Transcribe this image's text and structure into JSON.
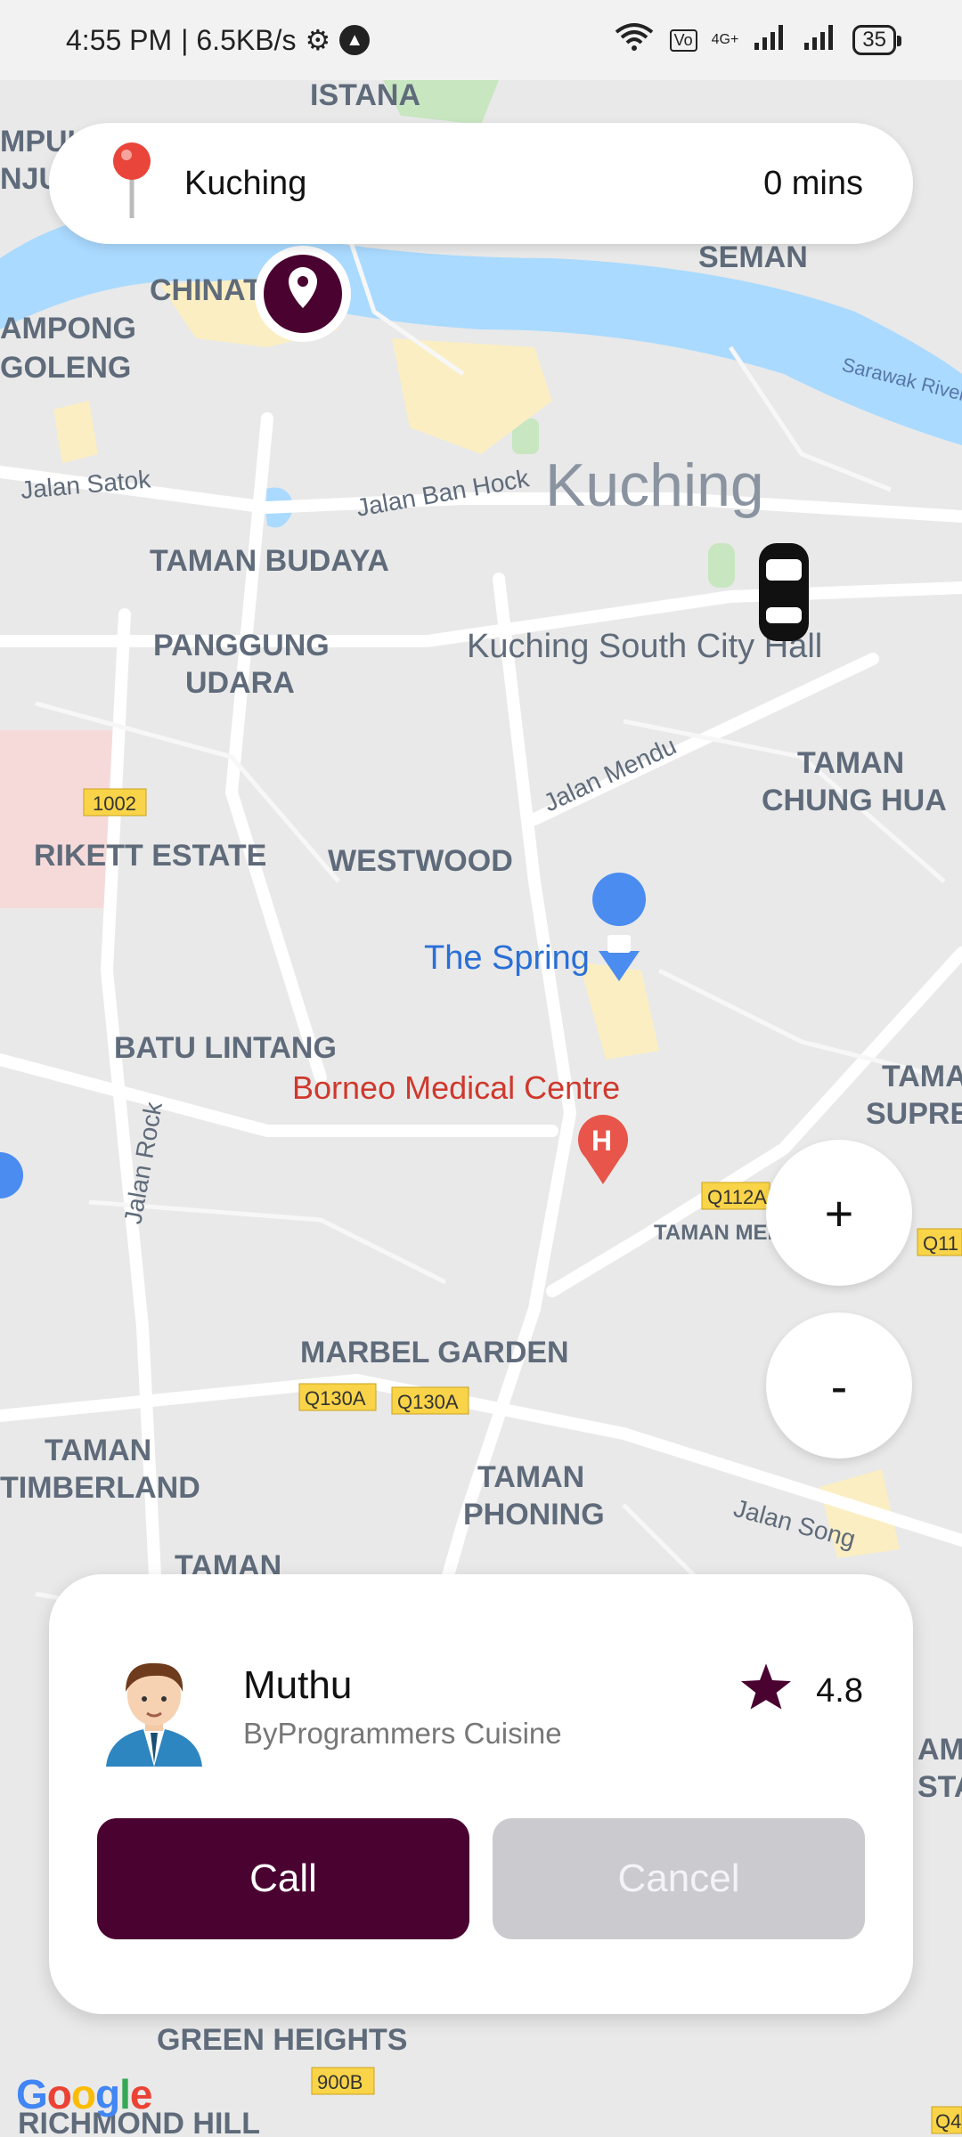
{
  "status_bar": {
    "time": "4:55 PM",
    "speed": "| 6.5KB/s",
    "battery": "35",
    "network": "4G+"
  },
  "search": {
    "location": "Kuching",
    "eta": "0 mins"
  },
  "map": {
    "labels": {
      "istana": "ISTANA",
      "kampung": "MPUI",
      "kampung2": "NJU",
      "chinatown": "CHINAT",
      "seman": "SEMAN",
      "kampong_goleng1": "AMPONG",
      "kampong_goleng2": "GOLENG",
      "sarawak_river": "Sarawak River",
      "jalan_satok": "Jalan Satok",
      "jalan_ban_hock": "Jalan Ban Hock",
      "kuching": "Kuching",
      "taman_budaya": "TAMAN BUDAYA",
      "kuching_south": "Kuching South City Hall",
      "panggung1": "PANGGUNG",
      "panggung2": "UDARA",
      "taman_chung_hua1": "TAMAN",
      "taman_chung_hua2": "CHUNG HUA",
      "jalan_mendu": "Jalan Mendu",
      "road_1002": "1002",
      "rikett": "RIKETT ESTATE",
      "westwood": "WESTWOOD",
      "the_spring": "The Spring",
      "batu_lintang": "BATU LINTANG",
      "borneo_medical": "Borneo Medical Centre",
      "tama_supre1": "TAMA",
      "tama_supre2": "SUPRE",
      "road_q112": "Q112A",
      "road_q11": "Q11",
      "taman_mel": "TAMAN MEL",
      "jalan_rock": "Jalan Rock",
      "marbel": "MARBEL GARDEN",
      "q130a_1": "Q130A",
      "q130a_2": "Q130A",
      "taman_timberland1": "TAMAN",
      "taman_timberland2": "TIMBERLAND",
      "taman_phoning1": "TAMAN",
      "taman_phoning2": "PHONING",
      "jalan_song": "Jalan Song",
      "taman_partial": "TAMAN",
      "green_heights": "GREEN HEIGHTS",
      "road_900b": "900B",
      "richmond": "RICHMOND HILL",
      "am_star1": "AM",
      "am_star2": "STA",
      "road_q4": "Q4"
    }
  },
  "zoom": {
    "in": "+",
    "out": "-"
  },
  "driver": {
    "name": "Muthu",
    "company": "ByProgrammers Cuisine",
    "rating": "4.8",
    "call_label": "Call",
    "cancel_label": "Cancel"
  },
  "google": {
    "logo": "Google"
  },
  "colors": {
    "brand": "#4a0230",
    "cancel": "#cacacf",
    "water": "#aadaff",
    "map_bg": "#e9e9e9"
  }
}
